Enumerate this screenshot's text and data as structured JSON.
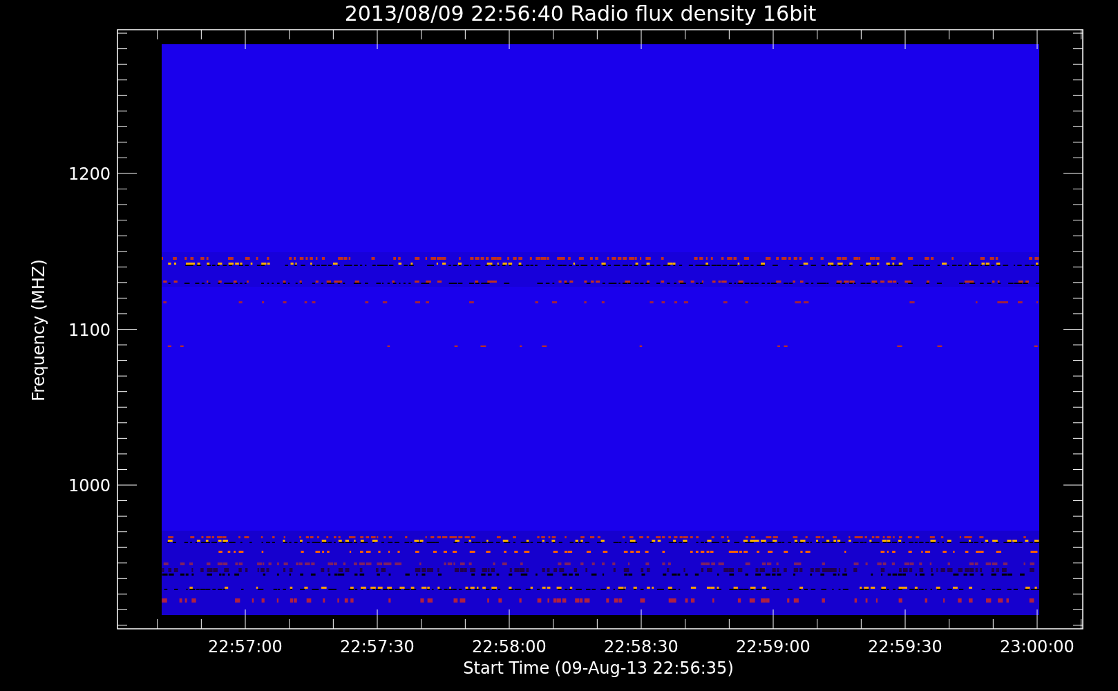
{
  "title": "2013/08/09 22:56:40 Radio flux density 16bit",
  "y_axis": {
    "label": "Frequency (MHZ)",
    "ticks": [
      "1200",
      "1100",
      "1000"
    ]
  },
  "x_axis": {
    "label": "Start Time (09-Aug-13 22:56:35)",
    "ticks": [
      "22:57:00",
      "22:57:30",
      "22:58:00",
      "22:58:30",
      "22:59:00",
      "22:59:30",
      "23:00:00"
    ]
  }
}
